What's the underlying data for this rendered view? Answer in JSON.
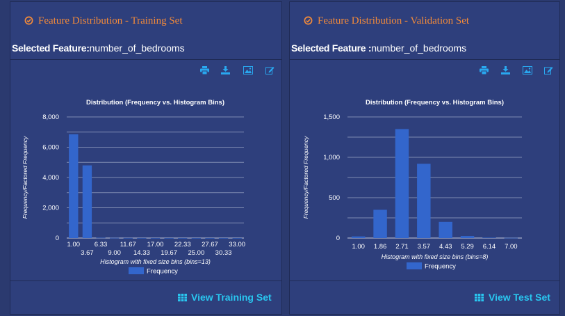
{
  "panels": [
    {
      "title": "Feature Distribution - Training Set",
      "selected_label": "Selected Feature:",
      "selected_value": "number_of_bedrooms",
      "button": "View Training Set"
    },
    {
      "title": "Feature Distribution - Validation Set",
      "selected_label": "Selected Feature :",
      "selected_value": "number_of_bedrooms",
      "button": "View Test Set"
    }
  ],
  "colors": {
    "accent": "#f28a3a",
    "bar": "#3366cc",
    "link": "#29c7f0",
    "panel": "#2e3f7c"
  },
  "chart_data": [
    {
      "type": "bar",
      "title": "Distribution (Frequency vs. Histogram Bins)",
      "xlabel": "Histogram with fixed size bins (bins=13)",
      "ylabel": "Frequency/Factored Frequency",
      "legend": "Frequency",
      "categories": [
        "1.00",
        "3.67",
        "6.33",
        "9.00",
        "11.67",
        "14.33",
        "17.00",
        "19.67",
        "22.33",
        "25.00",
        "27.67",
        "30.33",
        "33.00"
      ],
      "values": [
        6850,
        4800,
        20,
        10,
        5,
        3,
        2,
        1,
        1,
        1,
        1,
        1,
        1
      ],
      "yticks": [
        "0",
        "2,000",
        "4,000",
        "6,000",
        "8,000"
      ],
      "ylim": [
        0,
        8000
      ],
      "grid_lines": 9
    },
    {
      "type": "bar",
      "title": "Distribution (Frequency vs. Histogram Bins)",
      "xlabel": "Histogram with fixed size bins (bins=8)",
      "ylabel": "Frequency/Factored Frequency",
      "legend": "Frequency",
      "categories": [
        "1.00",
        "1.86",
        "2.71",
        "3.57",
        "4.43",
        "5.29",
        "6.14",
        "7.00"
      ],
      "values": [
        20,
        350,
        1350,
        920,
        200,
        25,
        5,
        2
      ],
      "yticks": [
        "0",
        "500",
        "1,000",
        "1,500"
      ],
      "ylim": [
        0,
        1500
      ],
      "grid_lines": 7
    }
  ]
}
